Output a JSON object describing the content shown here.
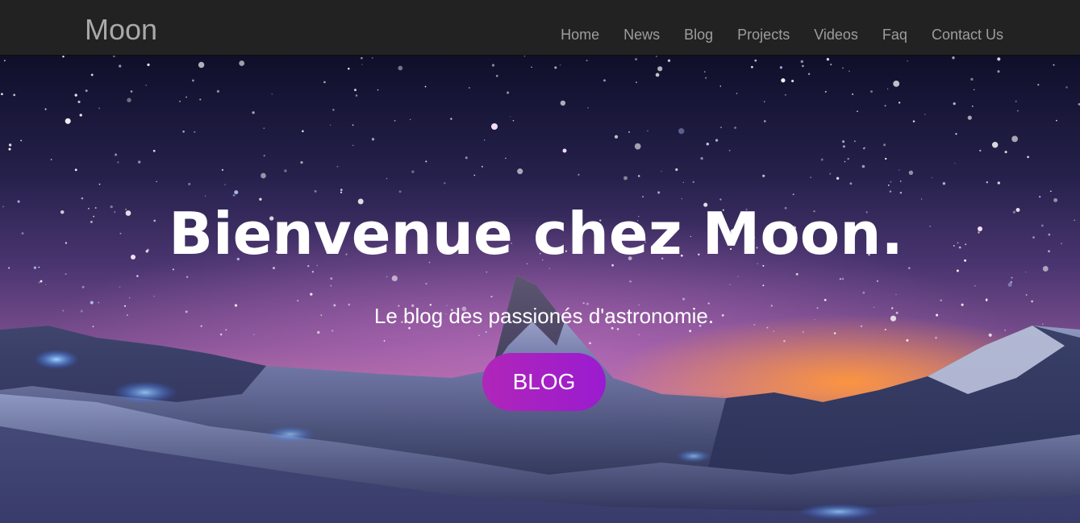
{
  "navbar": {
    "brand": "Moon",
    "links": [
      "Home",
      "News",
      "Blog",
      "Projects",
      "Videos",
      "Faq",
      "Contact Us"
    ]
  },
  "hero": {
    "title": "Bienvenue chez Moon.",
    "subtitle": "Le blog des passionés d'astronomie.",
    "button_label": "BLOG",
    "background": "starry-night-mountain-photo"
  },
  "colors": {
    "navbar_bg": "#222222",
    "nav_text": "#9d9d9d",
    "button_start": "#b026b9",
    "button_end": "#9a1bd0"
  }
}
